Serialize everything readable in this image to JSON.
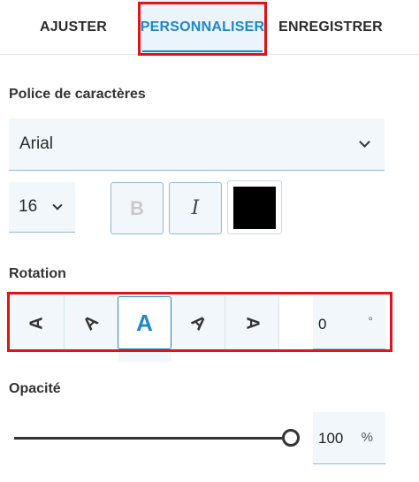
{
  "tabs": [
    {
      "label": "AJUSTER",
      "active": false
    },
    {
      "label": "PERSONNALISER",
      "active": true
    },
    {
      "label": "ENREGISTRER",
      "active": false
    }
  ],
  "font_section": {
    "label": "Police de caractères",
    "font_value": "Arial",
    "size_value": "16",
    "bold_label": "B",
    "italic_label": "I",
    "color": "#000000"
  },
  "rotation": {
    "label": "Rotation",
    "options": [
      {
        "glyph": "A",
        "angle": -90,
        "selected": false
      },
      {
        "glyph": "A",
        "angle": -45,
        "selected": false
      },
      {
        "glyph": "A",
        "angle": 0,
        "selected": true
      },
      {
        "glyph": "A",
        "angle": 45,
        "selected": false
      },
      {
        "glyph": "A",
        "angle": 90,
        "selected": false
      }
    ],
    "value": "0",
    "unit": "°"
  },
  "opacity": {
    "label": "Opacité",
    "value": "100",
    "unit": "%",
    "level": 1.0
  },
  "colors": {
    "accent": "#1e88c9",
    "highlight": "#e01414",
    "field_bg": "#f1f7fb"
  }
}
